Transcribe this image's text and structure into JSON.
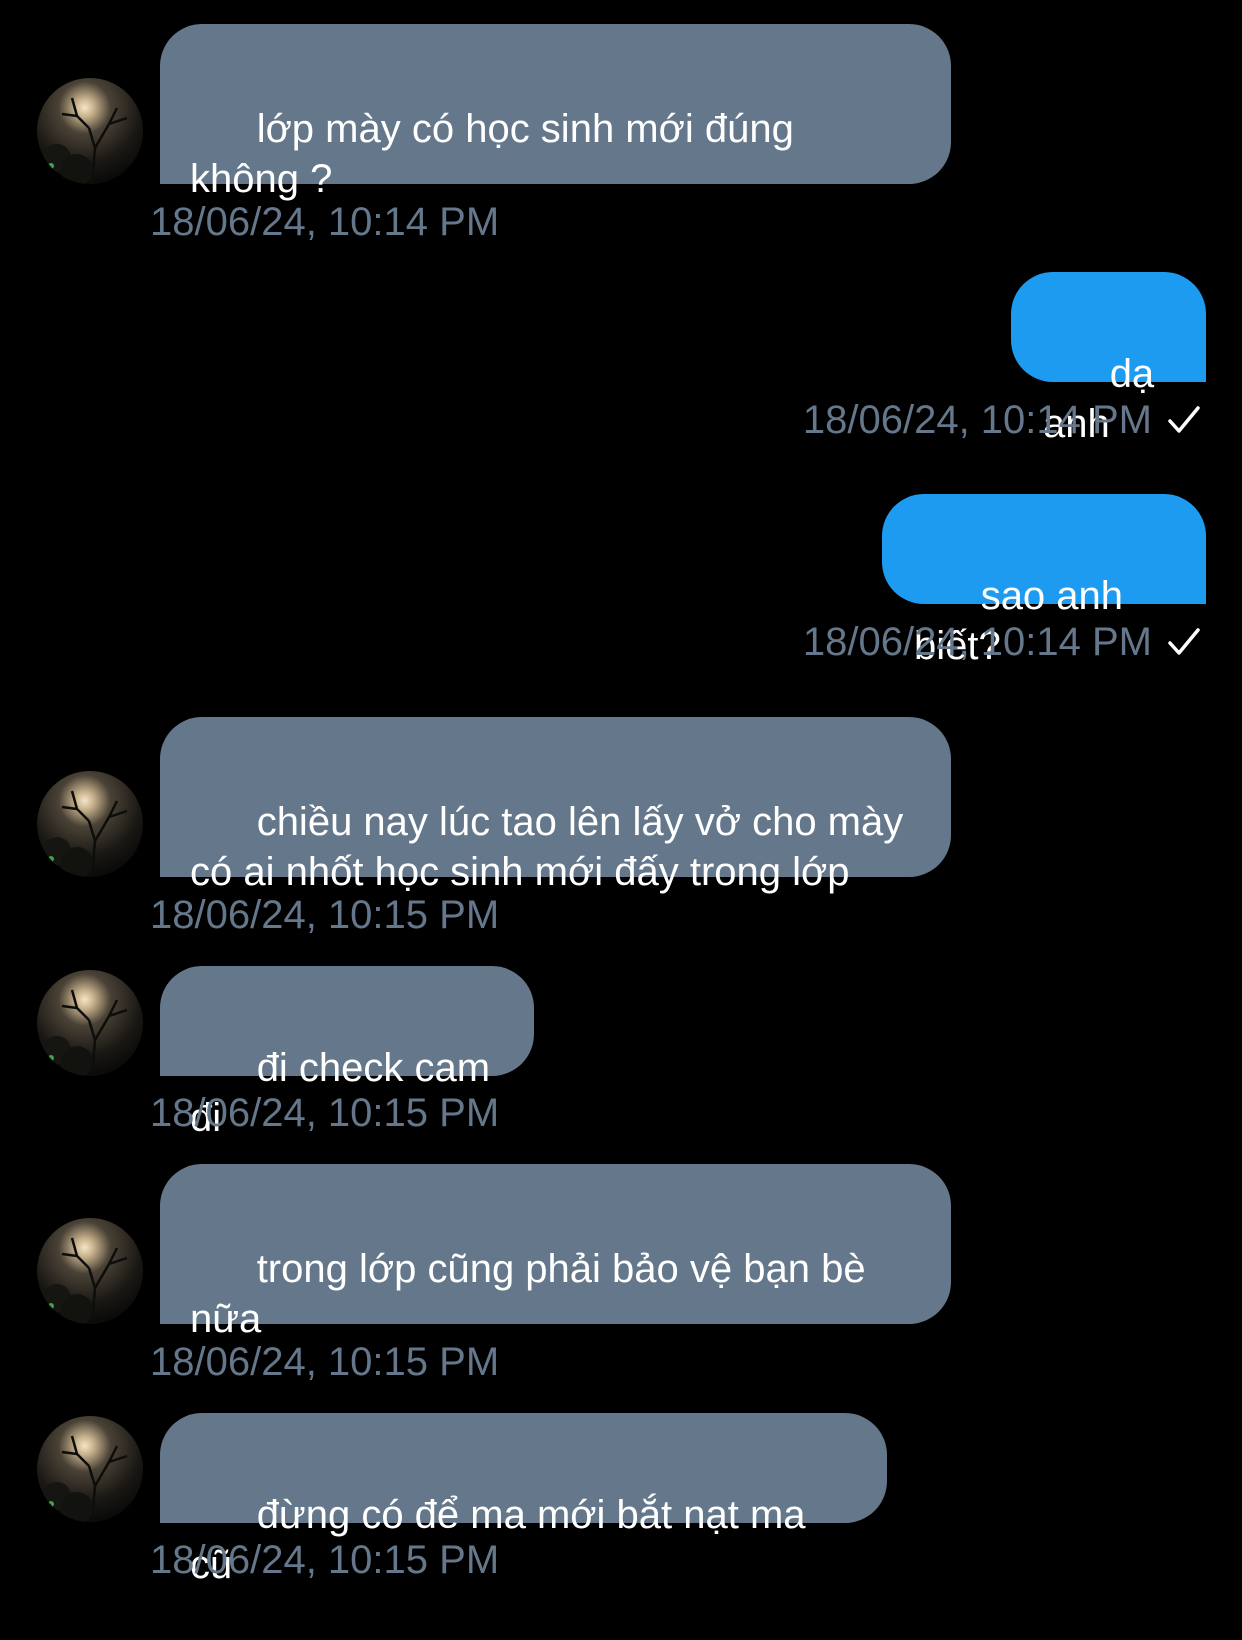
{
  "colors": {
    "background": "#000000",
    "incoming_bubble": "#65778a",
    "outgoing_bubble": "#1d9bf0",
    "timestamp": "#65778a",
    "text": "#ffffff"
  },
  "messages": [
    {
      "direction": "incoming",
      "text": "lớp mày có học sinh mới đúng\nkhông ?",
      "time": "18/06/24, 10:14 PM",
      "has_avatar": true
    },
    {
      "direction": "outgoing",
      "text": "dạ anh",
      "time": "18/06/24, 10:14 PM",
      "status_icon": "check-icon"
    },
    {
      "direction": "outgoing",
      "text": "sao anh biết?",
      "time": "18/06/24, 10:14 PM",
      "status_icon": "check-icon"
    },
    {
      "direction": "incoming",
      "text": "chiều nay lúc tao lên lấy vở cho mày\ncó ai nhốt học sinh mới đấy trong lớp",
      "time": "18/06/24, 10:15 PM",
      "has_avatar": true
    },
    {
      "direction": "incoming",
      "text": "đi check cam đi",
      "time": "18/06/24, 10:15 PM",
      "has_avatar": true
    },
    {
      "direction": "incoming",
      "text": "trong lớp cũng phải bảo vệ bạn bè\nnữa",
      "time": "18/06/24, 10:15 PM",
      "has_avatar": true
    },
    {
      "direction": "incoming",
      "text": "đừng có để ma mới bắt nạt ma cũ",
      "time": "18/06/24, 10:15 PM",
      "has_avatar": true
    }
  ]
}
